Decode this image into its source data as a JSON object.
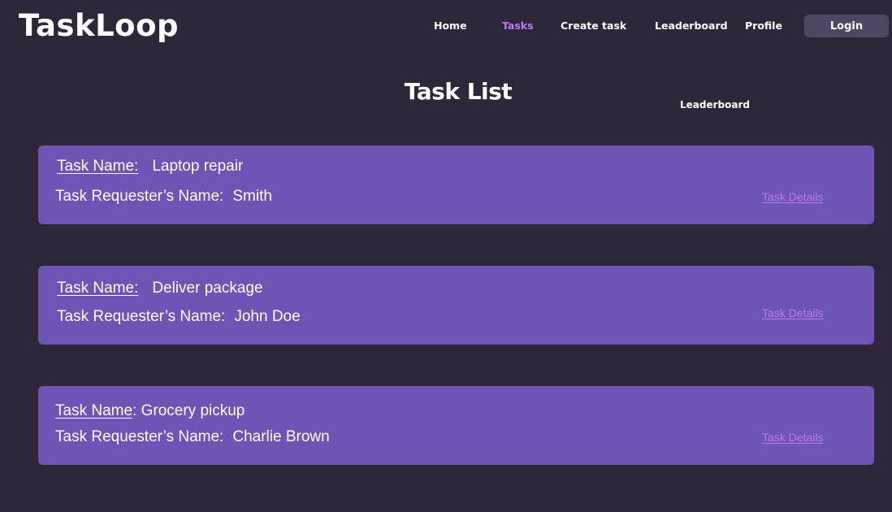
{
  "app": {
    "logo": "TaskLoop"
  },
  "nav": {
    "items": [
      {
        "label": "Home",
        "active": false
      },
      {
        "label": "Tasks",
        "active": true
      },
      {
        "label": "Create task",
        "active": false
      },
      {
        "label": "Leaderboard",
        "active": false
      },
      {
        "label": "Profile",
        "active": false
      }
    ],
    "login_label": "Login"
  },
  "page": {
    "title": "Task List",
    "leaderboard_link": "Leaderboard"
  },
  "tasks": [
    {
      "name_label": "Task Name:",
      "name": "Laptop repair",
      "requester_label": "Task Requester’s Name:",
      "requester": "Smith",
      "details_label": "Task Details"
    },
    {
      "name_label": "Task Name:",
      "name": "Deliver package",
      "requester_label": "Task Requester’s Name:",
      "requester": "John Doe",
      "details_label": "Task Details"
    },
    {
      "name_label": "Task Name",
      "name": "Grocery pickup",
      "requester_label": "Task Requester’s Name:",
      "requester": "Charlie Brown",
      "details_label": "Task Details"
    }
  ],
  "colors": {
    "background": "#2d2739",
    "card": "#6e55b5",
    "accent": "#b77cf2",
    "login_button": "#4e4761"
  }
}
